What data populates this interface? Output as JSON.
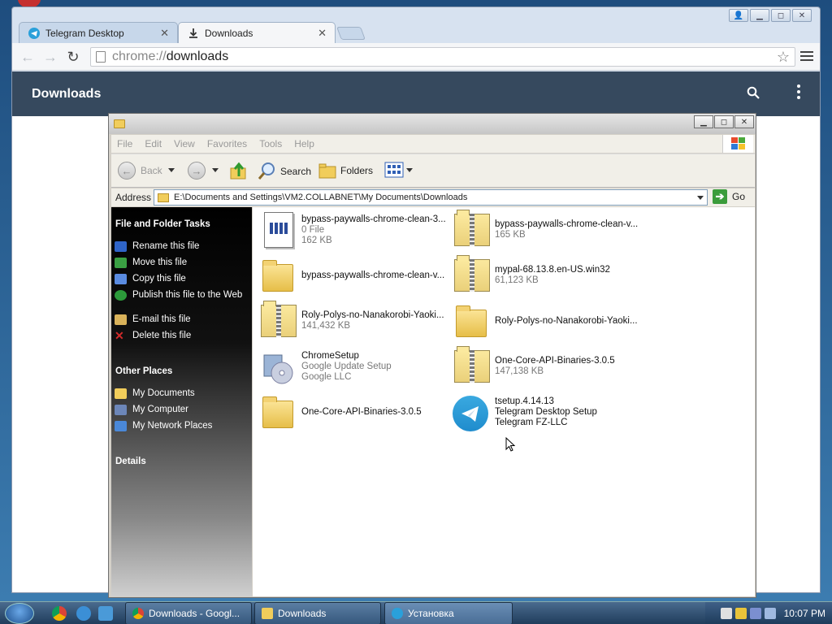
{
  "browser": {
    "tabs": [
      {
        "title": "Telegram Desktop"
      },
      {
        "title": "Downloads"
      }
    ],
    "url_scheme": "chrome://",
    "url_host": "downloads",
    "page_title": "Downloads"
  },
  "explorer": {
    "menu": [
      "File",
      "Edit",
      "View",
      "Favorites",
      "Tools",
      "Help"
    ],
    "toolbar": {
      "back": "Back",
      "search": "Search",
      "folders": "Folders"
    },
    "address_label": "Address",
    "address_path": "E:\\Documents and Settings\\VM2.COLLABNET\\My Documents\\Downloads",
    "go_label": "Go",
    "tasks_title": "File and Folder Tasks",
    "tasks": [
      {
        "label": "Rename this file",
        "color": "#2f64c8"
      },
      {
        "label": "Move this file",
        "color": "#3aa043"
      },
      {
        "label": "Copy this file",
        "color": "#5a8be0"
      },
      {
        "label": "Publish this file to the Web",
        "color": "#2c9a3a"
      },
      {
        "label": "E-mail this file",
        "color": "#d9b25a"
      },
      {
        "label": "Delete this file",
        "color": "#d22b2b"
      }
    ],
    "places_title": "Other Places",
    "places": [
      {
        "label": "My Documents",
        "color": "#f1cd5b"
      },
      {
        "label": "My Computer",
        "color": "#6c86b8"
      },
      {
        "label": "My Network Places",
        "color": "#4a88d8"
      }
    ],
    "details_title": "Details",
    "files": [
      {
        "name": "bypass-paywalls-chrome-clean-3....",
        "l2": "0 File",
        "l3": "162 KB",
        "icon": "document-icon"
      },
      {
        "name": "bypass-paywalls-chrome-clean-v...",
        "l2": "165 KB",
        "l3": "",
        "icon": "zip-icon"
      },
      {
        "name": "bypass-paywalls-chrome-clean-v...",
        "l2": "",
        "l3": "",
        "icon": "folder-icon"
      },
      {
        "name": "mypal-68.13.8.en-US.win32",
        "l2": "61,123 KB",
        "l3": "",
        "icon": "zip-icon"
      },
      {
        "name": "Roly-Polys-no-Nanakorobi-Yaoki...",
        "l2": "141,432 KB",
        "l3": "",
        "icon": "zip-icon"
      },
      {
        "name": "Roly-Polys-no-Nanakorobi-Yaoki...",
        "l2": "",
        "l3": "",
        "icon": "folder-icon"
      },
      {
        "name": "ChromeSetup",
        "l2": "Google Update Setup",
        "l3": "Google LLC",
        "icon": "installer-icon"
      },
      {
        "name": "One-Core-API-Binaries-3.0.5",
        "l2": "147,138 KB",
        "l3": "",
        "icon": "zip-icon"
      },
      {
        "name": "One-Core-API-Binaries-3.0.5",
        "l2": "",
        "l3": "",
        "icon": "folder-icon"
      },
      {
        "name": "tsetup.4.14.13",
        "l2": "Telegram Desktop Setup",
        "l3": "Telegram FZ-LLC",
        "icon": "telegram-icon"
      }
    ]
  },
  "taskbar": {
    "buttons": [
      "Downloads - Googl...",
      "Downloads",
      "Установка"
    ],
    "clock": "10:07 PM"
  }
}
